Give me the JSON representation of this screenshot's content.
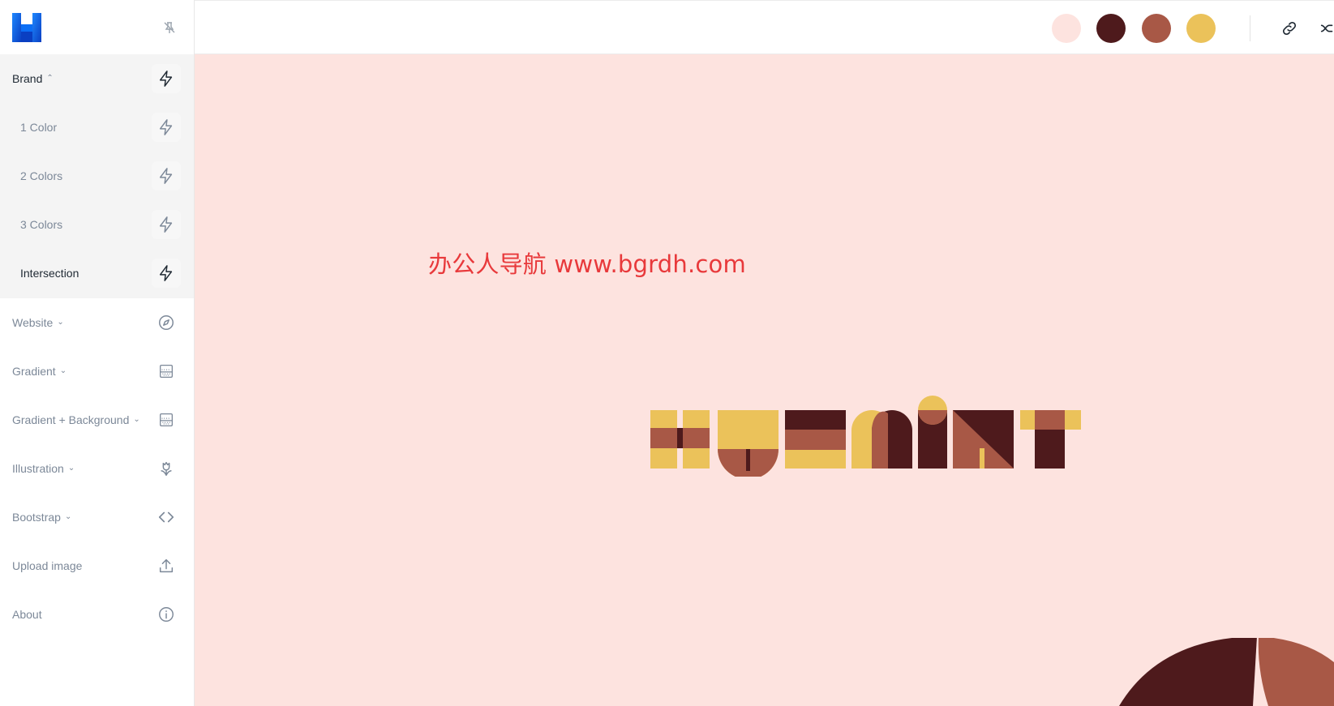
{
  "app": {
    "logo_icon": "huemint-logo-icon",
    "pin_icon": "pin-icon"
  },
  "sidebar": {
    "brand": {
      "label": "Brand",
      "chevron": "⌃",
      "icon": "lightning-icon"
    },
    "brand_items": [
      {
        "label": "1 Color",
        "icon": "lightning-icon"
      },
      {
        "label": "2 Colors",
        "icon": "lightning-icon"
      },
      {
        "label": "3 Colors",
        "icon": "lightning-icon"
      },
      {
        "label": "Intersection",
        "icon": "lightning-icon"
      }
    ],
    "website": {
      "label": "Website",
      "chevron": "⌄",
      "icon": "compass-icon"
    },
    "gradient": {
      "label": "Gradient",
      "chevron": "⌄",
      "icon": "gradient-icon"
    },
    "gradient_bg": {
      "label": "Gradient + Background",
      "chevron": "⌄",
      "icon": "gradient-icon"
    },
    "illustration": {
      "label": "Illustration",
      "chevron": "⌄",
      "icon": "flower-icon"
    },
    "bootstrap": {
      "label": "Bootstrap",
      "chevron": "⌄",
      "icon": "code-icon"
    },
    "upload": {
      "label": "Upload image",
      "icon": "upload-icon"
    },
    "about": {
      "label": "About",
      "icon": "info-icon"
    }
  },
  "palette": {
    "colors": [
      "#fde3df",
      "#4e1a1c",
      "#a85846",
      "#ebc25a"
    ]
  },
  "toolbar": {
    "link_icon": "link-icon",
    "shuffle_icon": "shuffle-icon"
  },
  "canvas": {
    "background": "#fde3df",
    "watermark_text": "办公人导航 www.bgrdh.com",
    "watermark_color": "#e8393b",
    "wordmark_icon": "huemint-wordmark-illustration",
    "corner_icon": "semicircle-shapes-illustration"
  }
}
